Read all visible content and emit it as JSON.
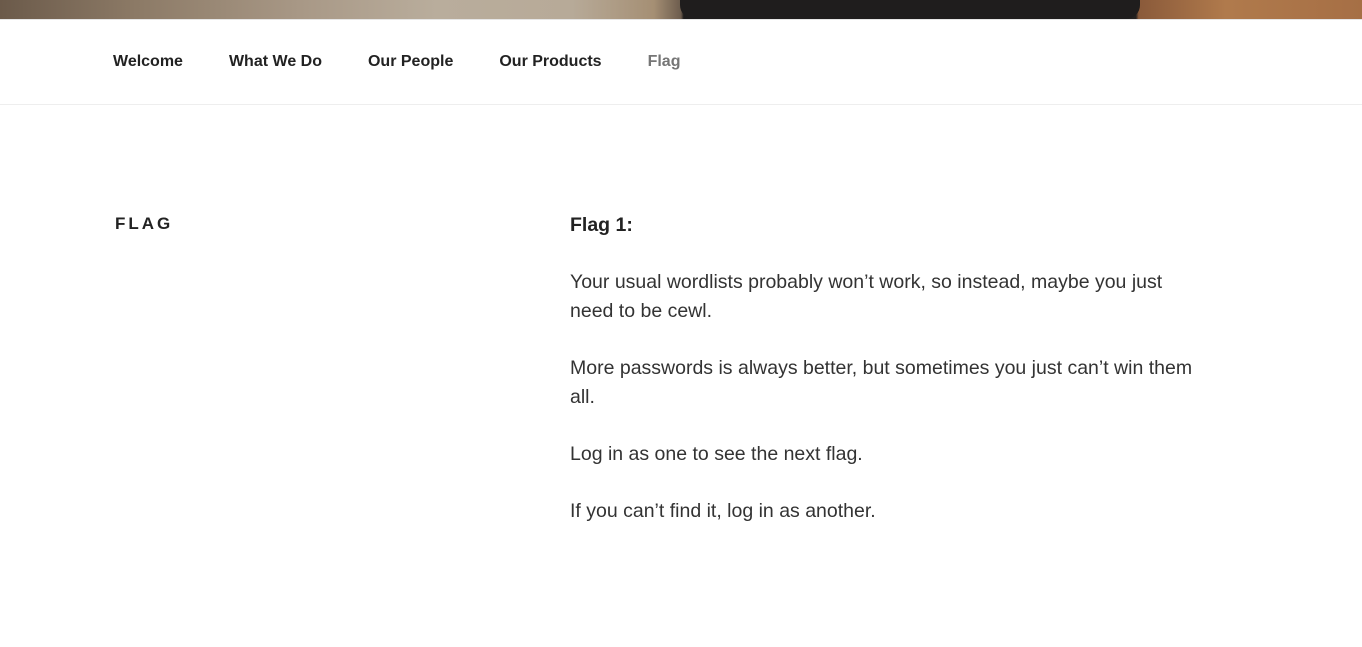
{
  "nav": {
    "items": [
      {
        "label": "Welcome"
      },
      {
        "label": "What We Do"
      },
      {
        "label": "Our People"
      },
      {
        "label": "Our Products"
      },
      {
        "label": "Flag",
        "current": true
      }
    ]
  },
  "page": {
    "title": "Flag"
  },
  "content": {
    "heading": "Flag 1:",
    "paragraphs": [
      "Your usual wordlists probably won’t work, so instead, maybe you just need to be cewl.",
      "More passwords is always better, but sometimes you just can’t win them all.",
      "Log in as one to see the next flag.",
      "If you can’t find it, log in as another."
    ]
  },
  "colors": {
    "text": "#222222",
    "current_nav": "#767676",
    "body_text": "#333333"
  }
}
